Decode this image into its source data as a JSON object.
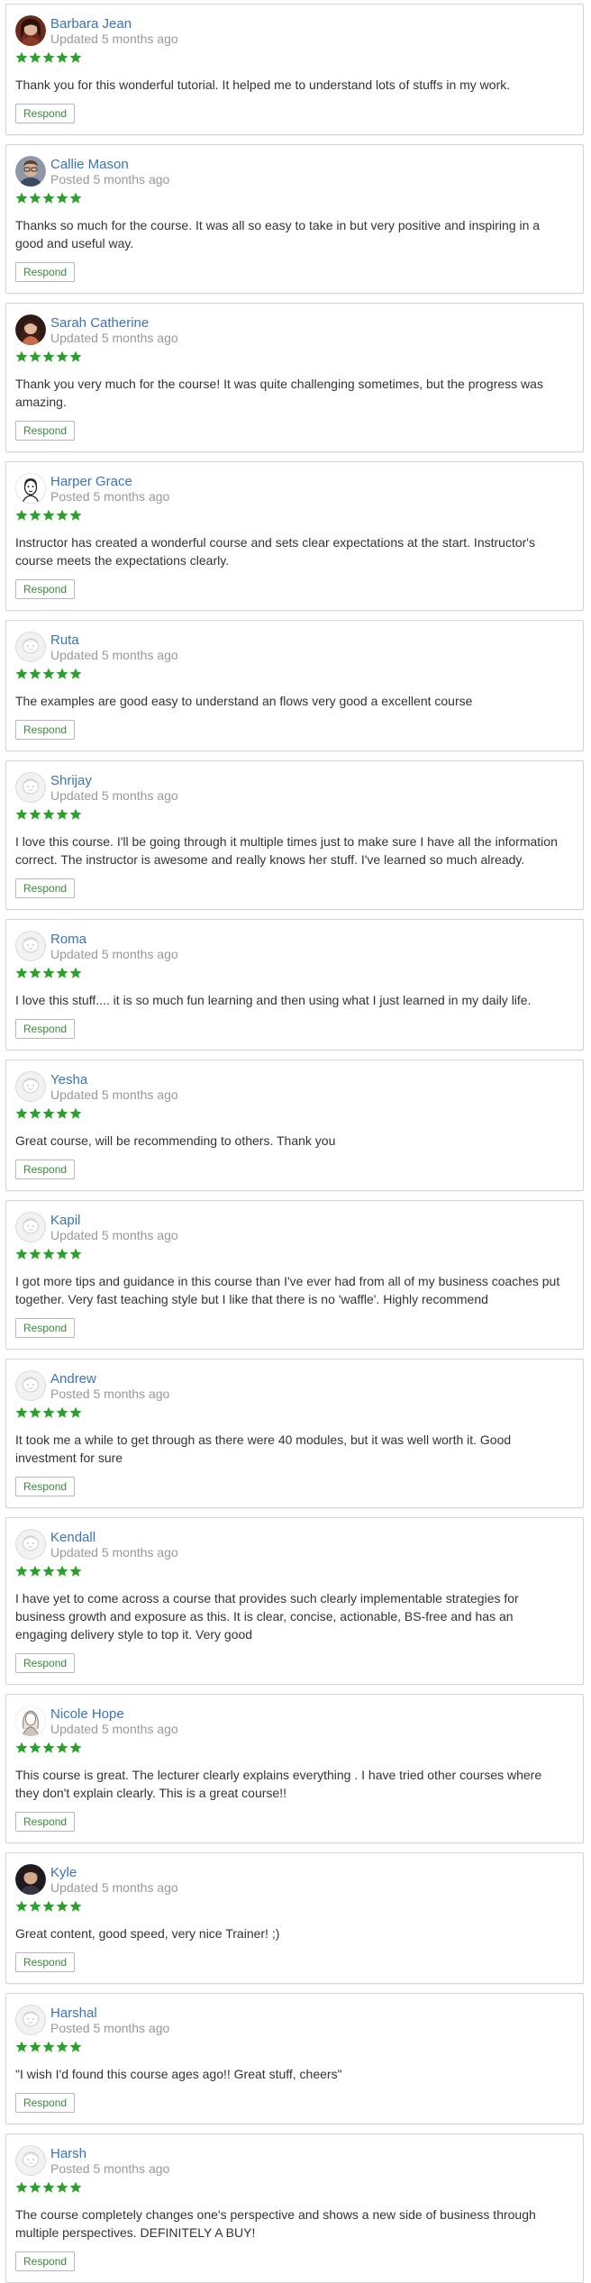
{
  "colors": {
    "name_link": "#3a74b8",
    "date_text": "#999999",
    "star": "#2ca02c",
    "respond_text": "#3b8a3b",
    "card_border": "#d4d4d4"
  },
  "respond_label": "Respond",
  "reviews": [
    {
      "name": "Barbara Jean",
      "date": "Updated 5 months ago",
      "rating": 5,
      "avatar": "photo-woman-dark-hair",
      "text": "Thank you for this wonderful tutorial. It helped me to understand lots of stuffs in my work."
    },
    {
      "name": "Callie Mason",
      "date": "Posted 5 months ago",
      "rating": 5,
      "avatar": "photo-man-glasses",
      "text": "Thanks so much for the course. It was all so easy to take in but very positive and inspiring in a good and useful way."
    },
    {
      "name": "Sarah Catherine",
      "date": "Updated 5 months ago",
      "rating": 5,
      "avatar": "photo-woman-long-hair",
      "text": "Thank you very much for the course! It was quite challenging sometimes, but the progress was amazing."
    },
    {
      "name": "Harper Grace",
      "date": "Posted 5 months ago",
      "rating": 5,
      "avatar": "sketch-man",
      "text": "Instructor has created a wonderful course and sets clear expectations at the start. Instructor's course meets the expectations clearly."
    },
    {
      "name": "Ruta",
      "date": "Updated 5 months ago",
      "rating": 5,
      "avatar": "default-avatar",
      "text": "The examples are good easy to understand an flows very good a excellent course"
    },
    {
      "name": "Shrijay",
      "date": "Updated 5 months ago",
      "rating": 5,
      "avatar": "default-avatar",
      "text": "I love this course. I'll be going through it multiple times just to make sure I have all the information correct. The instructor is awesome and really knows her stuff. I've learned so much already."
    },
    {
      "name": "Roma",
      "date": "Updated 5 months ago",
      "rating": 5,
      "avatar": "default-avatar",
      "text": "I love this stuff.... it is so much fun learning and then using what I just learned in my daily life."
    },
    {
      "name": "Yesha",
      "date": "Updated 5 months ago",
      "rating": 5,
      "avatar": "default-avatar",
      "text": "Great course, will be recommending to others. Thank you"
    },
    {
      "name": "Kapil",
      "date": "Updated 5 months ago",
      "rating": 5,
      "avatar": "default-avatar",
      "text": "I got more tips and guidance in this course than I've ever had from all of my business coaches put together. Very fast teaching style but I like that there is no 'waffle'. Highly recommend"
    },
    {
      "name": "Andrew",
      "date": "Posted 5 months ago",
      "rating": 5,
      "avatar": "default-avatar",
      "text": "It took me a while to get through as there were 40 modules, but it was well worth it. Good investment for sure"
    },
    {
      "name": "Kendall",
      "date": "Updated 5 months ago",
      "rating": 5,
      "avatar": "default-avatar",
      "text": "I have yet to come across a course that provides such clearly implementable strategies for business growth and exposure as this. It is clear, concise, actionable, BS-free and has an engaging delivery style to top it. Very good"
    },
    {
      "name": "Nicole Hope",
      "date": "Updated 5 months ago",
      "rating": 5,
      "avatar": "sketch-woman",
      "text": "This course is great. The lecturer clearly explains everything . I have tried other courses where they don't explain clearly. This is a great course!!"
    },
    {
      "name": "Kyle",
      "date": "Updated 5 months ago",
      "rating": 5,
      "avatar": "photo-man-short-hair",
      "text": "Great content, good speed, very nice Trainer! ;)"
    },
    {
      "name": "Harshal",
      "date": "Posted 5 months ago",
      "rating": 5,
      "avatar": "default-avatar",
      "text": "\"I wish I'd found this course ages ago!! Great stuff, cheers\""
    },
    {
      "name": "Harsh",
      "date": "Posted 5 months ago",
      "rating": 5,
      "avatar": "default-avatar",
      "text": "The course completely changes one's perspective and shows a new side of business through multiple perspectives. DEFINITELY A BUY!"
    }
  ]
}
